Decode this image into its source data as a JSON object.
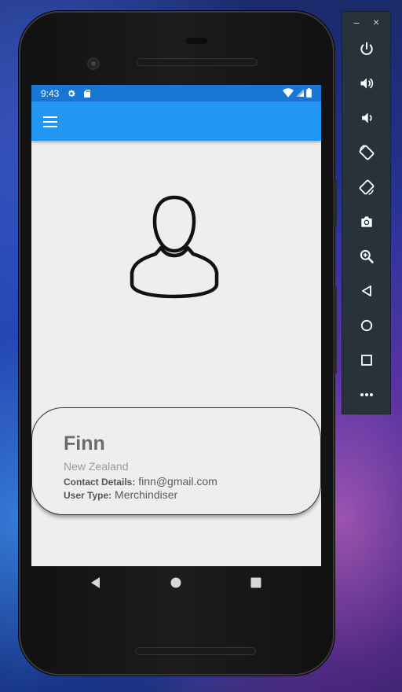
{
  "status_bar": {
    "time": "9:43",
    "icons": [
      "gear-icon",
      "sd-card-icon",
      "wifi-icon",
      "signal-icon",
      "battery-icon"
    ]
  },
  "app_bar": {
    "menu_icon": "hamburger-menu-icon",
    "color": "#2196f3",
    "status_color": "#1976d2"
  },
  "profile": {
    "avatar_icon": "person-outline-icon",
    "name": "Finn",
    "country": "New Zealand",
    "contact_label": "Contact Details:",
    "contact_value": "finn@gmail.com",
    "user_type_label": "User Type:",
    "user_type_value": "Merchindiser"
  },
  "nav_bar": {
    "buttons": [
      "back-icon",
      "home-icon",
      "recents-icon"
    ]
  },
  "emulator_toolbar": {
    "minimize": "−",
    "close": "×",
    "buttons": [
      "power-icon",
      "volume-up-icon",
      "volume-down-icon",
      "rotate-left-icon",
      "rotate-right-icon",
      "camera-icon",
      "zoom-icon",
      "back-icon",
      "home-icon",
      "overview-icon",
      "more-icon"
    ]
  }
}
